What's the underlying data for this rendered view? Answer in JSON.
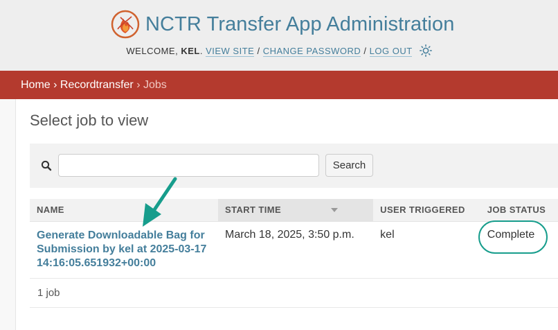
{
  "header": {
    "title": "NCTR Transfer App Administration",
    "welcome_prefix": "WELCOME,",
    "username": "KEL",
    "view_site": "VIEW SITE",
    "change_password": "CHANGE PASSWORD",
    "log_out": "LOG OUT",
    "separator": "/",
    "theme_icon": "sun-icon"
  },
  "breadcrumbs": {
    "home": "Home",
    "app": "Recordtransfer",
    "current": "Jobs",
    "separator": "›"
  },
  "page": {
    "title": "Select job to view"
  },
  "search": {
    "value": "",
    "placeholder": "",
    "button_label": "Search"
  },
  "table": {
    "columns": [
      "NAME",
      "START TIME",
      "USER TRIGGERED",
      "JOB STATUS"
    ],
    "sorted_column": "START TIME",
    "rows": [
      {
        "name": "Generate Downloadable Bag for Submission by kel at 2025-03-17 14:16:05.651932+00:00",
        "start_time": "March 18, 2025, 3:50 p.m.",
        "user_triggered": "kel",
        "job_status": "Complete"
      }
    ]
  },
  "paginator": {
    "count_text": "1 job"
  },
  "colors": {
    "brand_blue": "#447e9b",
    "breadcrumb_red": "#b43a2e",
    "annotation_teal": "#179d8c"
  }
}
